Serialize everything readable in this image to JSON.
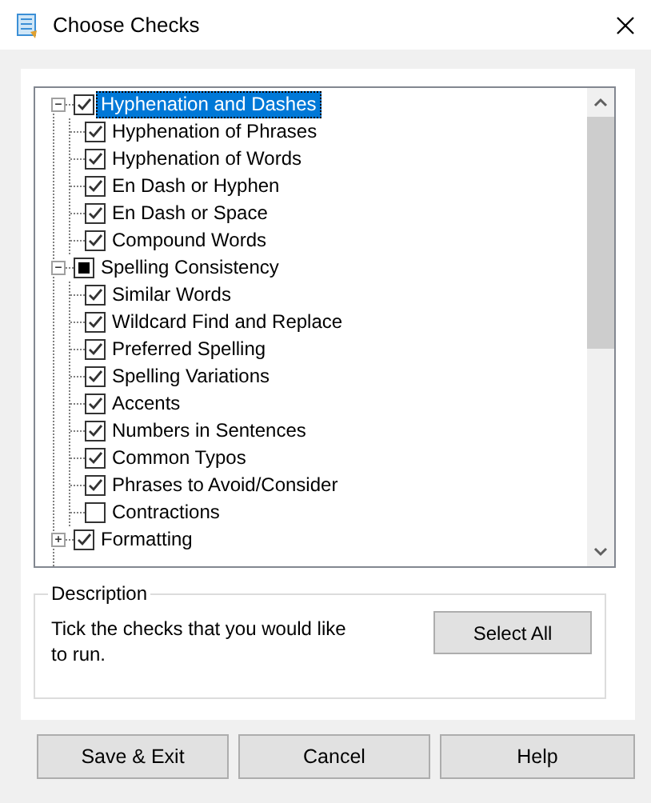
{
  "window": {
    "title": "Choose Checks"
  },
  "tree": [
    {
      "label": "Hyphenation and Dashes",
      "checked": true,
      "indeterminate": false,
      "expanded": true,
      "selected": true,
      "children": [
        {
          "label": "Hyphenation of Phrases",
          "checked": true,
          "selected": false
        },
        {
          "label": "Hyphenation of Words",
          "checked": true,
          "selected": false
        },
        {
          "label": "En Dash or Hyphen",
          "checked": true,
          "selected": false
        },
        {
          "label": "En Dash or Space",
          "checked": true,
          "selected": false
        },
        {
          "label": "Compound Words",
          "checked": true,
          "selected": false
        }
      ]
    },
    {
      "label": "Spelling Consistency",
      "checked": false,
      "indeterminate": true,
      "expanded": true,
      "selected": false,
      "children": [
        {
          "label": "Similar Words",
          "checked": true,
          "selected": false
        },
        {
          "label": "Wildcard Find and Replace",
          "checked": true,
          "selected": false
        },
        {
          "label": "Preferred Spelling",
          "checked": true,
          "selected": false
        },
        {
          "label": "Spelling Variations",
          "checked": true,
          "selected": false
        },
        {
          "label": "Accents",
          "checked": true,
          "selected": false
        },
        {
          "label": "Numbers in Sentences",
          "checked": true,
          "selected": false
        },
        {
          "label": "Common Typos",
          "checked": true,
          "selected": false
        },
        {
          "label": "Phrases to Avoid/Consider",
          "checked": true,
          "selected": false
        },
        {
          "label": "Contractions",
          "checked": false,
          "selected": false
        }
      ]
    },
    {
      "label": "Formatting",
      "checked": true,
      "indeterminate": false,
      "expanded": false,
      "selected": false
    }
  ],
  "description": {
    "legend": "Description",
    "text": "Tick the checks that you would like  to run.",
    "button": "Select All"
  },
  "buttons": [
    "Save & Exit",
    "Cancel",
    "Help"
  ]
}
